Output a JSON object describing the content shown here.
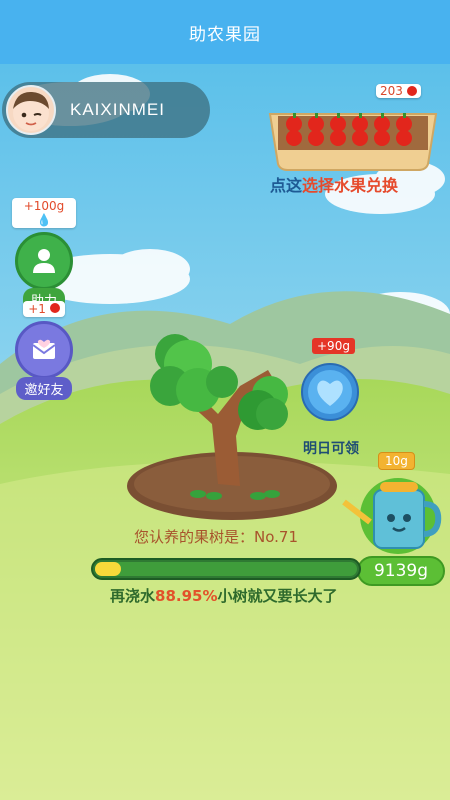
{
  "header": {
    "title": "助农果园"
  },
  "user": {
    "name": "KAIXINMEI"
  },
  "basket": {
    "count": "203",
    "exchange_prefix": "点这",
    "exchange_highlight": "选择水果兑换"
  },
  "help_button": {
    "reward": "+100g",
    "label": "助力"
  },
  "invite_button": {
    "reward": "+1",
    "label": "邀好友"
  },
  "bonus": {
    "amount": "+90g",
    "label": "明日可领"
  },
  "tree": {
    "caption": "您认养的果树是：No.71"
  },
  "progress": {
    "fraction": 0.1
  },
  "message": {
    "prefix": "再浇水",
    "percent": "88.95%",
    "suffix": "小树就又要长大了"
  },
  "watering_can": {
    "per_use": "10g",
    "total": "9139g"
  },
  "colors": {
    "header": "#48b2ef",
    "sky": "#79cdea",
    "grass": "#8fcf4f",
    "accent_red": "#e53527"
  }
}
